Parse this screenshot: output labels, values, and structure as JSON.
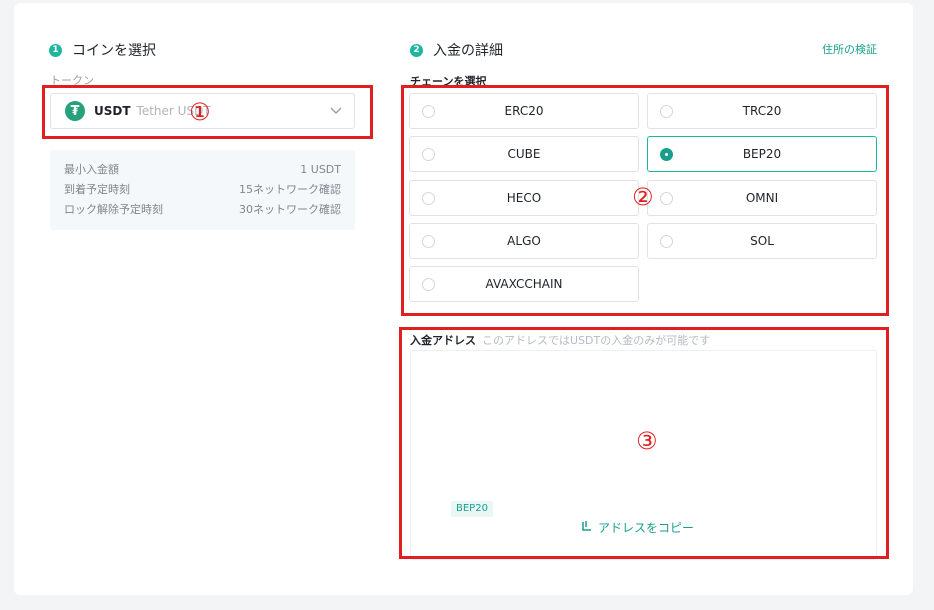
{
  "step1": {
    "number": "1",
    "title": "コインを選択"
  },
  "step2": {
    "number": "2",
    "title": "入金の詳細",
    "verify_link": "住所の検証"
  },
  "token": {
    "label": "トークン",
    "icon": "tether-icon",
    "icon_glyph": "₮",
    "symbol": "USDT",
    "name": "Tether USDT"
  },
  "info": [
    {
      "label": "最小入金額",
      "value": "1 USDT"
    },
    {
      "label": "到着予定時刻",
      "value": "15ネットワーク確認"
    },
    {
      "label": "ロック解除予定時刻",
      "value": "30ネットワーク確認"
    }
  ],
  "chain": {
    "heading": "チェーンを選択",
    "selected": "BEP20",
    "options": [
      {
        "label": "ERC20"
      },
      {
        "label": "TRC20"
      },
      {
        "label": "CUBE"
      },
      {
        "label": "BEP20"
      },
      {
        "label": "HECO"
      },
      {
        "label": "OMNI"
      },
      {
        "label": "ALGO"
      },
      {
        "label": "SOL"
      },
      {
        "label": "AVAXCCHAIN"
      }
    ]
  },
  "address": {
    "title": "入金アドレス",
    "note": "このアドレスではUSDTの入金のみが可能です",
    "chain_badge": "BEP20",
    "copy_label": "アドレスをコピー"
  },
  "annotations": {
    "one": "①",
    "two": "②",
    "three": "③",
    "color": "#e02020"
  },
  "colors": {
    "accent": "#1fb6a0",
    "link": "#1a9e8c"
  }
}
